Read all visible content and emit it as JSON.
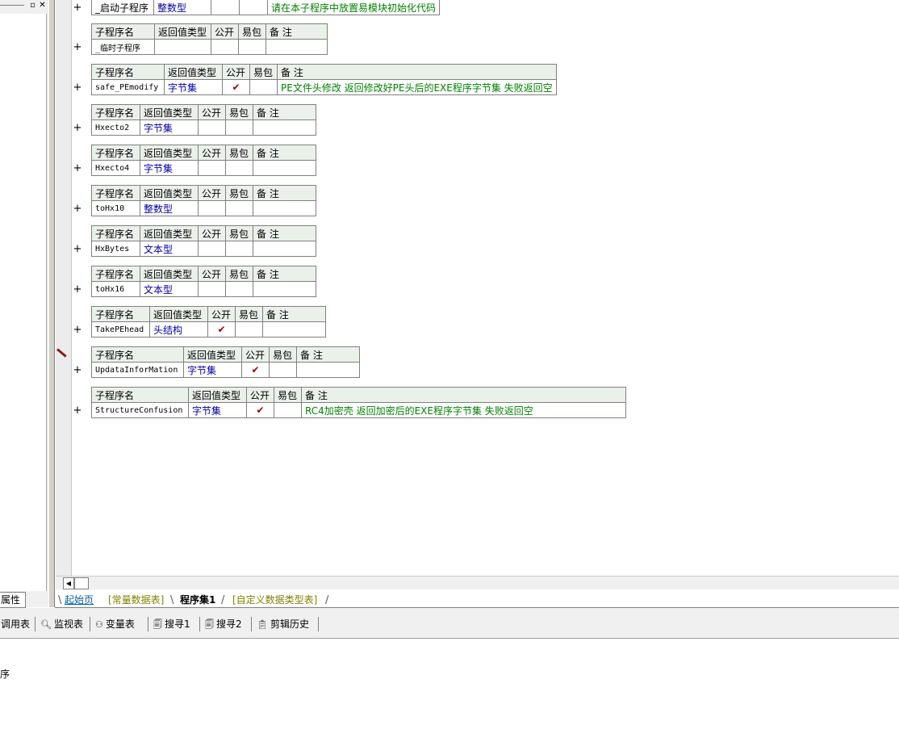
{
  "left_panel": {
    "properties_tab": "属性",
    "restore_icon": "restore-icon",
    "close_icon": "close-icon"
  },
  "editor": {
    "header": {
      "name": "子程序名",
      "return_type": "返回值类型",
      "public": "公开",
      "easy_pack": "易包",
      "remark": "备 注"
    },
    "first_row": {
      "name": "_启动子程序",
      "return_type": "整数型",
      "remark": "请在本子程序中放置易模块初始化代码"
    },
    "subs": [
      {
        "name": "_临时子程序",
        "return_type": "",
        "public": "",
        "remark": ""
      },
      {
        "name": "safe_PEmodify",
        "return_type": "字节集",
        "public": "✔",
        "remark": "PE文件头修改 返回修改好PE头后的EXE程序字节集 失败返回空"
      },
      {
        "name": "Hxecto2",
        "return_type": "字节集",
        "public": "",
        "remark": ""
      },
      {
        "name": "Hxecto4",
        "return_type": "字节集",
        "public": "",
        "remark": ""
      },
      {
        "name": "toHx10",
        "return_type": "整数型",
        "public": "",
        "remark": ""
      },
      {
        "name": "HxBytes",
        "return_type": "文本型",
        "public": "",
        "remark": ""
      },
      {
        "name": "toHx16",
        "return_type": "文本型",
        "public": "",
        "remark": ""
      },
      {
        "name": "TakePEhead",
        "return_type": "头结构",
        "public": "✔",
        "remark": ""
      },
      {
        "name": "UpdataInforMation",
        "return_type": "字节集",
        "public": "✔",
        "remark": ""
      },
      {
        "name": "StructureConfusion",
        "return_type": "字节集",
        "public": "✔",
        "remark": "RC4加密壳 返回加密后的EXE程序字节集 失败返回空"
      }
    ],
    "expand_symbol": "+"
  },
  "tabs": {
    "start": "起始页",
    "constants": "[常量数据表]",
    "program_set": "程序集1",
    "custom_types": "[自定义数据类型表]"
  },
  "toolbar": {
    "call_table": "调用表",
    "watch": "监视表",
    "variables": "变量表",
    "search1": "搜寻1",
    "search2": "搜寻2",
    "clip_history": "剪辑历史"
  },
  "output": {
    "text": "序"
  }
}
